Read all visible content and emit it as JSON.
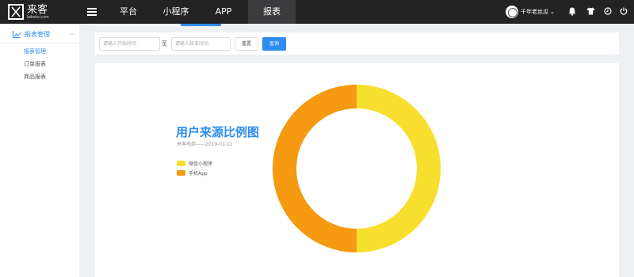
{
  "brand": {
    "name_cn": "来客",
    "name_en": "laikeitui.com"
  },
  "topnav": {
    "items": [
      {
        "label": "平台"
      },
      {
        "label": "小程序"
      },
      {
        "label": "APP"
      },
      {
        "label": "报表"
      }
    ],
    "active_index": 3,
    "user_name": "千年老丝瓜"
  },
  "sidebar": {
    "section_label": "报表管理",
    "items": [
      {
        "label": "报表管理"
      },
      {
        "label": "订单报表"
      },
      {
        "label": "商品报表"
      }
    ],
    "active_index": 0
  },
  "filter": {
    "start_placeholder": "请输入开始时间",
    "separator": "至",
    "end_placeholder": "请输入结束时间",
    "reset_label": "重置",
    "query_label": "查询"
  },
  "colors": {
    "accent": "#2d8cf0",
    "topbar": "#232324"
  },
  "chart_data": {
    "type": "pie",
    "title": "用户来源比例图",
    "subtitle": "来客电商——2019-01-11",
    "series": [
      {
        "name": "微信小程序",
        "value": 50,
        "color": "#f8df2d"
      },
      {
        "name": "手机App",
        "value": 50,
        "color": "#f59a11"
      }
    ],
    "donut": true,
    "legend_position": "left"
  }
}
